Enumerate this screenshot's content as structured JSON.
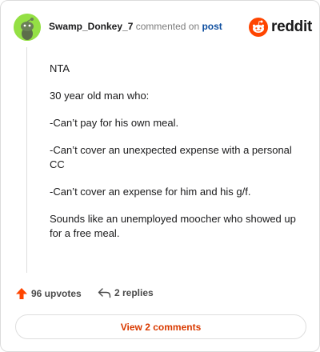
{
  "header": {
    "author": "Swamp_Donkey_7",
    "action": "commented on",
    "post_link": "post",
    "brand": "reddit",
    "avatar_color": "#94e044",
    "brand_color": "#ff4500"
  },
  "comment": {
    "paragraphs": [
      "NTA",
      "30 year old man who:",
      "-Can’t pay for his own meal.",
      "-Can’t cover an unexpected expense with a personal CC",
      "-Can’t cover an expense for him and his g/f.",
      "Sounds like an unemployed moocher who showed up for a free meal."
    ]
  },
  "footer": {
    "upvotes": "96 upvotes",
    "replies": "2 replies",
    "view_comments": "View 2 comments",
    "upvote_icon": "arrow-up-icon",
    "reply_icon": "reply-arrow-icon"
  }
}
